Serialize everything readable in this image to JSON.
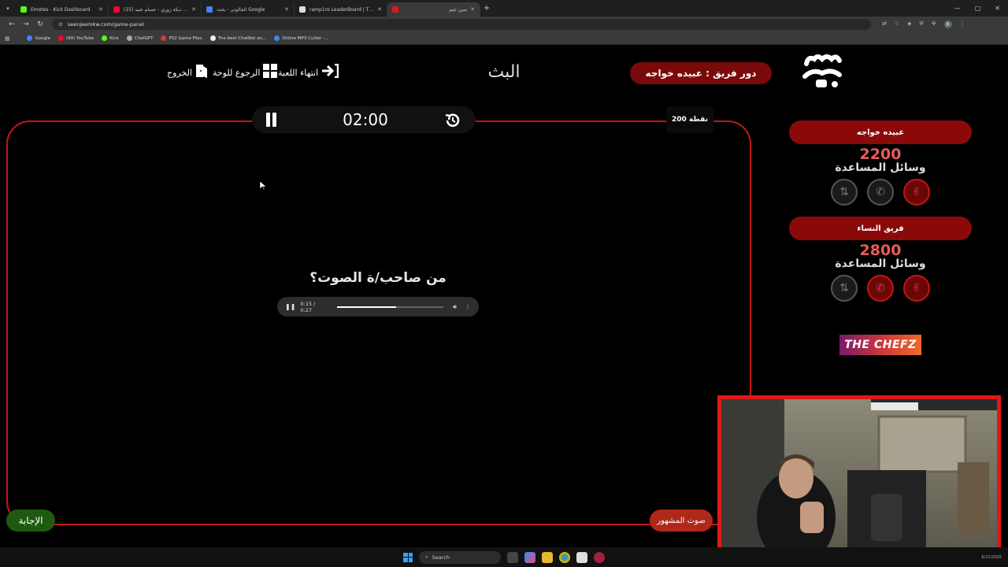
{
  "browser": {
    "tabs": [
      {
        "label": "Emotes - Kick Dashboard",
        "color": "#53fc18"
      },
      {
        "label": "(15) أقوى دبكة زوري - حسام جنيد",
        "color": "#ff0033"
      },
      {
        "label": "الجالوتي - بحث Google",
        "color": "#4285f4"
      },
      {
        "label": "ramp1re LeaderBoard | The bi...",
        "color": "#dddddd"
      },
      {
        "label": "سين جيم",
        "color": "#e01818"
      }
    ],
    "url": "seenjeemkw.com/game-panel",
    "bookmarks": [
      {
        "label": "Google",
        "color": "#4285f4"
      },
      {
        "label": "(99) YouTube",
        "color": "#ff0033"
      },
      {
        "label": "Kick",
        "color": "#53fc18"
      },
      {
        "label": "ChatGPT",
        "color": "#aaaaaa"
      },
      {
        "label": "PS2 Game Files",
        "color": "#d03a3a"
      },
      {
        "label": "The best ChatBot an...",
        "color": "#eeeeee"
      },
      {
        "label": "Online MP3 Cutter -...",
        "color": "#3a8aee"
      }
    ]
  },
  "game": {
    "nav": {
      "exit": "الخروج",
      "back_board": "الرجوع للوحة",
      "end_game": "انتهاء اللعبة"
    },
    "category": "البث",
    "turn_label": "دور فريق : عبيده خواجه",
    "timer": "02:00",
    "points": "200 نقطة",
    "question": "من صاحب/ة الصوت؟",
    "audio": {
      "time": "0:15 / 0:27",
      "progress": 0.56
    },
    "answer_button": "الإجابة",
    "hint_button": "صوت المشهور",
    "teams": [
      {
        "name": "عبيده خواجه",
        "score": "2200",
        "helpers_label": "وسائل المساعدة",
        "helpers_active": [
          false,
          false,
          true
        ]
      },
      {
        "name": "فريق النساء",
        "score": "2800",
        "helpers_label": "وسائل المساعدة",
        "helpers_active": [
          false,
          true,
          true
        ]
      }
    ],
    "sponsor": "THE CHEFZ"
  },
  "taskbar": {
    "search_placeholder": "Search",
    "clock": "6/21/2025"
  }
}
